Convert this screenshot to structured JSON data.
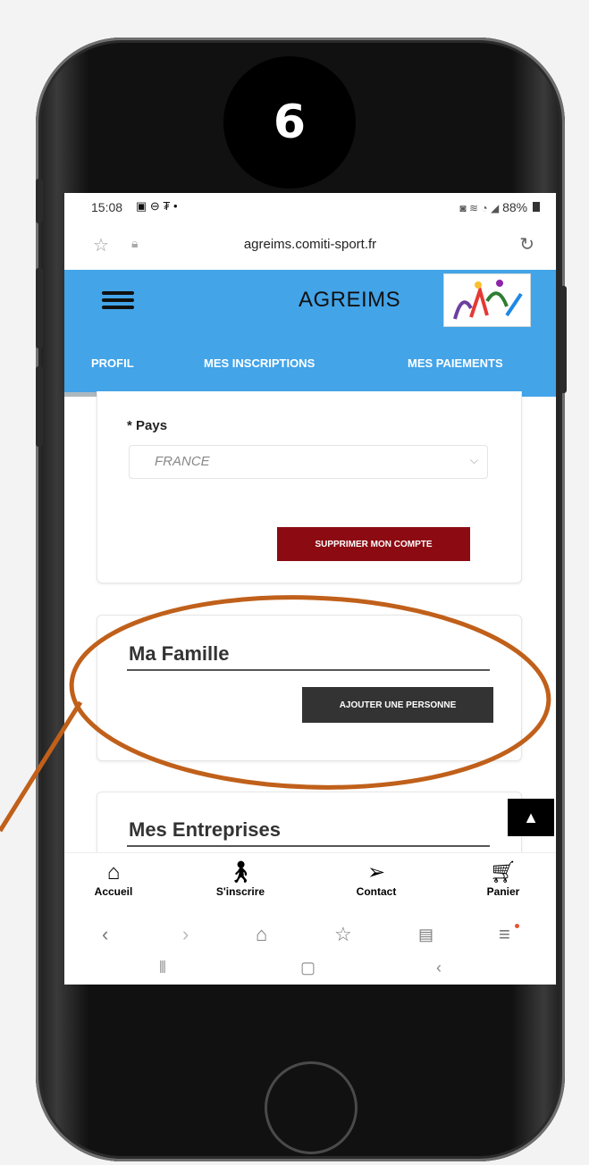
{
  "badge": {
    "number": "6"
  },
  "status_bar": {
    "time": "15:08",
    "left_icons": "▣ ⊖ ₮ •",
    "right_icons": "◙ ≋ ◔ ◢",
    "battery": "88%"
  },
  "browser": {
    "url": "agreims.comiti-sport.fr"
  },
  "app": {
    "title": "AGREIMS"
  },
  "tabs": [
    {
      "label": "PROFIL"
    },
    {
      "label": "MES INSCRIPTIONS"
    },
    {
      "label": "MES PAIEMENTS"
    }
  ],
  "form": {
    "country_label": "* Pays",
    "country_value": "FRANCE",
    "delete_account": "SUPPRIMER MON COMPTE"
  },
  "family": {
    "title": "Ma Famille",
    "add_person": "AJOUTER UNE PERSONNE"
  },
  "companies": {
    "title": "Mes Entreprises"
  },
  "bottom_nav": [
    {
      "label": "Accueil",
      "icon": "home-icon"
    },
    {
      "label": "S'inscrire",
      "icon": "walk-icon"
    },
    {
      "label": "Contact",
      "icon": "send-icon"
    },
    {
      "label": "Panier",
      "icon": "cart-icon"
    }
  ],
  "colors": {
    "appbar": "#43a4e8",
    "danger_button": "#8c0b13",
    "dark_button": "#333333",
    "highlight": "#c0601a"
  }
}
